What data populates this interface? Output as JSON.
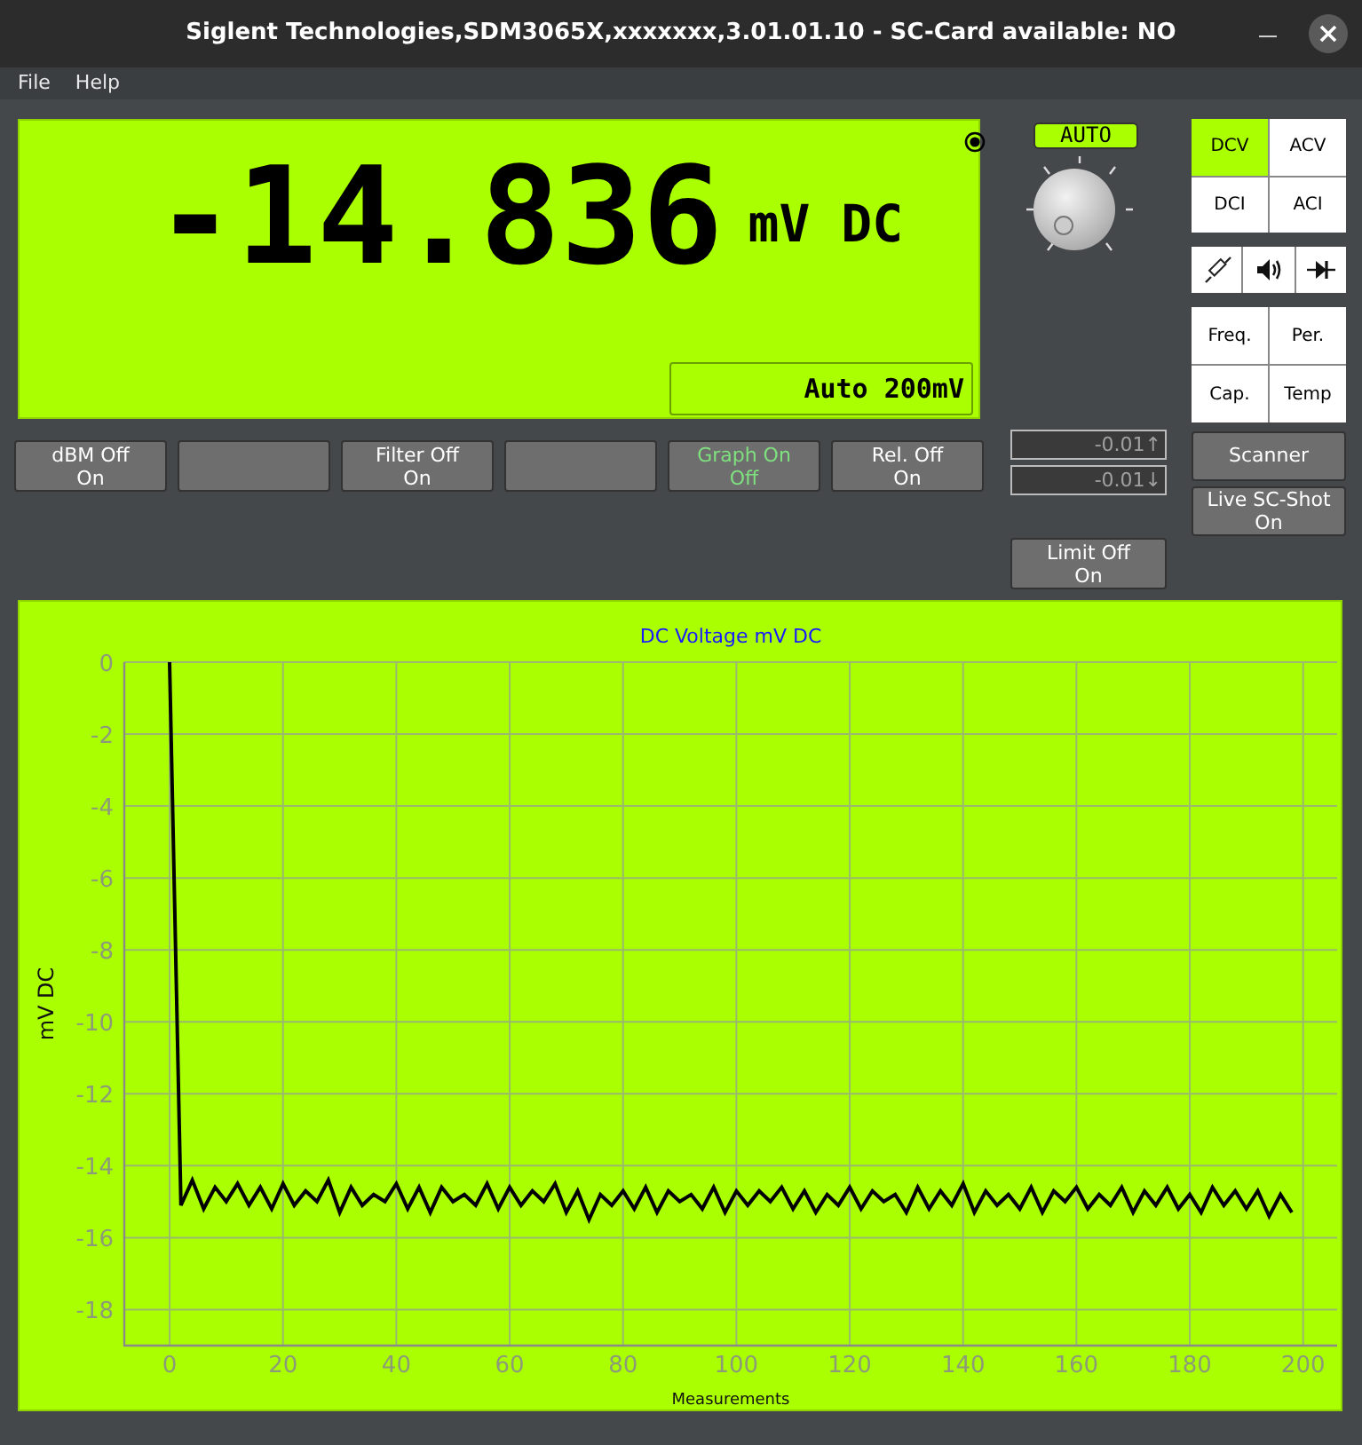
{
  "window": {
    "title": "Siglent Technologies,SDM3065X,xxxxxxx,3.01.01.10  - SC-Card available: NO"
  },
  "menu": [
    {
      "label": "File"
    },
    {
      "label": "Help"
    }
  ],
  "display": {
    "reading": "-14.836",
    "unit": "mV DC",
    "range": "Auto 200mV"
  },
  "function_buttons": [
    {
      "kind": "toggle",
      "line_1": "dBM Off",
      "line_2": "On",
      "active": false
    },
    {
      "kind": "blank"
    },
    {
      "kind": "toggle",
      "line_1": "Filter Off",
      "line_2": "On",
      "active": false
    },
    {
      "kind": "blank"
    },
    {
      "kind": "toggle",
      "line_1": "Graph On",
      "line_2": "Off",
      "active": true
    },
    {
      "kind": "toggle",
      "line_1": "Rel. Off",
      "line_2": "On",
      "active": false
    }
  ],
  "range_knob": {
    "label": "AUTO"
  },
  "limits": {
    "upper": "-0.01↑",
    "lower": "-0.01↓",
    "button": {
      "line_1": "Limit Off",
      "line_2": "On"
    }
  },
  "modes": [
    {
      "label": "DCV",
      "selected": true
    },
    {
      "label": "ACV",
      "selected": false
    },
    {
      "label": "DCI",
      "selected": false
    },
    {
      "label": "ACI",
      "selected": false
    }
  ],
  "special_modes": [
    {
      "kind": "resistance",
      "selected": false
    },
    {
      "kind": "continuity",
      "selected": false
    },
    {
      "kind": "diode",
      "selected": false
    }
  ],
  "other_modes": [
    {
      "label": "Freq.",
      "selected": false
    },
    {
      "label": "Per.",
      "selected": false
    },
    {
      "label": "Cap.",
      "selected": false
    },
    {
      "label": "Temp",
      "selected": false
    }
  ],
  "scanner_button": {
    "label": "Scanner"
  },
  "screenshot_button": {
    "line_1": "Live SC-Shot",
    "line_2": "On"
  },
  "graph": {
    "chart_data": {
      "type": "line",
      "title": "DC Voltage mV DC",
      "xlabel": "Measurements",
      "ylabel": "mV DC",
      "x": [
        0,
        2,
        4,
        6,
        8,
        10,
        12,
        14,
        16,
        18,
        20,
        22,
        24,
        26,
        28,
        30,
        32,
        34,
        36,
        38,
        40,
        42,
        44,
        46,
        48,
        50,
        52,
        54,
        56,
        58,
        60,
        62,
        64,
        66,
        68,
        70,
        72,
        74,
        76,
        78,
        80,
        82,
        84,
        86,
        88,
        90,
        92,
        94,
        96,
        98,
        100,
        102,
        104,
        106,
        108,
        110,
        112,
        114,
        116,
        118,
        120,
        122,
        124,
        126,
        128,
        130,
        132,
        134,
        136,
        138,
        140,
        142,
        144,
        146,
        148,
        150,
        152,
        154,
        156,
        158,
        160,
        162,
        164,
        166,
        168,
        170,
        172,
        174,
        176,
        178,
        180,
        182,
        184,
        186,
        188,
        190,
        192,
        194,
        196,
        198
      ],
      "series": [
        {
          "color": "#000000",
          "values": [
            0,
            -15.1,
            -14.4,
            -15.2,
            -14.6,
            -15.0,
            -14.5,
            -15.1,
            -14.6,
            -15.2,
            -14.5,
            -15.1,
            -14.7,
            -15.0,
            -14.4,
            -15.3,
            -14.6,
            -15.1,
            -14.8,
            -15.0,
            -14.5,
            -15.2,
            -14.6,
            -15.3,
            -14.6,
            -15.0,
            -14.8,
            -15.1,
            -14.5,
            -15.2,
            -14.6,
            -15.1,
            -14.7,
            -15.0,
            -14.5,
            -15.3,
            -14.7,
            -15.5,
            -14.8,
            -15.1,
            -14.7,
            -15.2,
            -14.6,
            -15.3,
            -14.7,
            -15.0,
            -14.8,
            -15.2,
            -14.6,
            -15.3,
            -14.7,
            -15.1,
            -14.7,
            -15.0,
            -14.6,
            -15.2,
            -14.7,
            -15.3,
            -14.8,
            -15.1,
            -14.6,
            -15.2,
            -14.7,
            -15.0,
            -14.8,
            -15.3,
            -14.6,
            -15.2,
            -14.7,
            -15.1,
            -14.5,
            -15.3,
            -14.7,
            -15.1,
            -14.8,
            -15.2,
            -14.6,
            -15.3,
            -14.7,
            -15.0,
            -14.6,
            -15.2,
            -14.8,
            -15.1,
            -14.6,
            -15.3,
            -14.7,
            -15.1,
            -14.6,
            -15.2,
            -14.8,
            -15.3,
            -14.6,
            -15.1,
            -14.7,
            -15.2,
            -14.7,
            -15.4,
            -14.8,
            -15.3
          ]
        }
      ],
      "grid": true,
      "xlim": [
        -8,
        206
      ],
      "ylim": [
        -19,
        0
      ],
      "xticks": [
        0,
        20,
        40,
        60,
        80,
        100,
        120,
        140,
        160,
        180,
        200
      ],
      "yticks": [
        0,
        -2,
        -4,
        -6,
        -8,
        -10,
        -12,
        -14,
        -16,
        -18
      ]
    }
  }
}
